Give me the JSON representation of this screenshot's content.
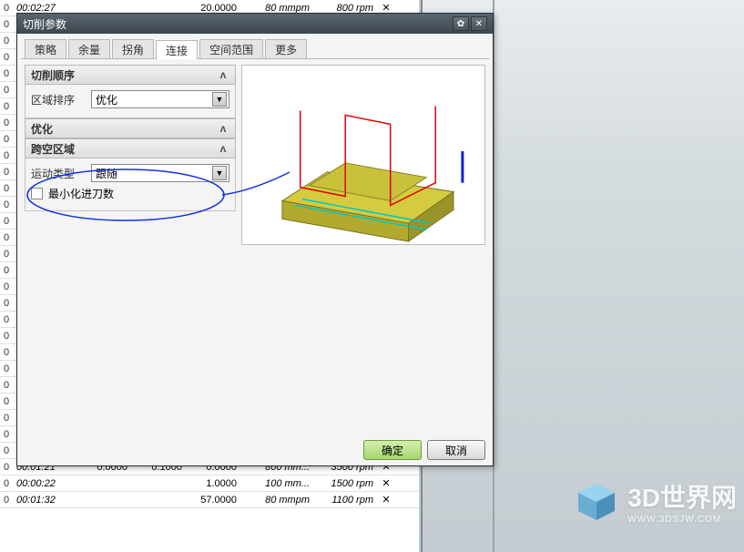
{
  "bg_header": {
    "time": "00:02:27",
    "v1": "20.0000",
    "v2": "80 mmpm",
    "v3": "800 rpm"
  },
  "bg_rows_zero_count": 27,
  "bg_rows_bottom": [
    {
      "c0": "0",
      "t": "00:01:21",
      "v1": "0.0000",
      "v2": "0.1000",
      "v3": "0.0000",
      "fr": "800 mm...",
      "sp": "3500 rpm",
      "x": "✕"
    },
    {
      "c0": "0",
      "t": "00:00:22",
      "v1": "",
      "v2": "",
      "v3": "1.0000",
      "fr": "100 mm...",
      "sp": "1500 rpm",
      "x": "✕"
    },
    {
      "c0": "0",
      "t": "00:01:32",
      "v1": "",
      "v2": "",
      "v3": "57.0000",
      "fr": "80 mmpm",
      "sp": "1100 rpm",
      "x": "✕"
    }
  ],
  "dialog": {
    "title": "切削参数",
    "tabs": [
      "策略",
      "余量",
      "拐角",
      "连接",
      "空间范围",
      "更多"
    ],
    "active_tab": 3,
    "sections": {
      "cut_order": {
        "title": "切削顺序",
        "row_label": "区域排序",
        "value": "优化"
      },
      "optimize": {
        "title": "优化"
      },
      "open_area": {
        "title": "跨空区域",
        "row_label": "运动类型",
        "value": "跟随",
        "chk_label": "最小化进刀数"
      }
    },
    "buttons": {
      "ok": "确定",
      "cancel": "取消"
    }
  },
  "watermark": {
    "main": "3D世界网",
    "sub": "WWW.3DSJW.COM"
  }
}
